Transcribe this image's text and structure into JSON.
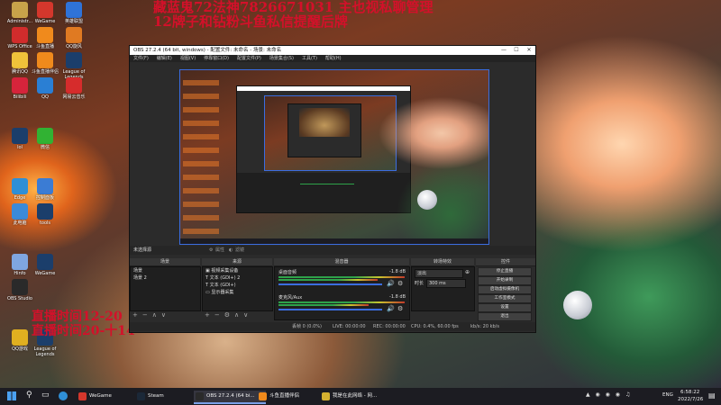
{
  "overlay": {
    "top_line1": "藏蓝鬼72法神7826671031 主也视私聊管理",
    "top_line2": "12牌子和钻粉斗鱼私信提醒后牌",
    "left_line1": "直播时间12-20",
    "left_line2": "直播时间20-十14"
  },
  "desktop_icons": [
    {
      "label": "Administr...",
      "color": "#c8a24a"
    },
    {
      "label": "WeGame",
      "color": "#d4372c"
    },
    {
      "label": "英雄联盟",
      "color": "#2f73d8"
    },
    {
      "label": "WPS Office",
      "color": "#d12c2c"
    },
    {
      "label": "斗鱼直播",
      "color": "#f08a1c"
    },
    {
      "label": "QQ旋风",
      "color": "#e07a22"
    },
    {
      "label": "腾讯QQ",
      "color": "#f0c23a"
    },
    {
      "label": "斗鱼直播伴侣",
      "color": "#f08a1c"
    },
    {
      "label": "League of Legends",
      "color": "#1b3e6b"
    },
    {
      "label": "Bilibili",
      "color": "#d6243b"
    },
    {
      "label": "QQ",
      "color": "#2a7fd4"
    },
    {
      "label": "网易云音乐",
      "color": "#d62c2c"
    },
    {
      "label": "lol",
      "color": "#1b3e6b"
    },
    {
      "label": "微信",
      "color": "#31b233"
    },
    {
      "label": "Edge",
      "color": "#2f8fd6"
    },
    {
      "label": "控制面板",
      "color": "#3b7cd4"
    },
    {
      "label": "此电脑",
      "color": "#3b8ad8"
    },
    {
      "label": "tools",
      "color": "#1b3e6b"
    },
    {
      "label": "Hinfo",
      "color": "#7fa6e0"
    },
    {
      "label": "WeGame",
      "color": "#1b3e6b"
    },
    {
      "label": "OBS Studio",
      "color": "#2a2a2a"
    },
    {
      "label": "QQ游戏",
      "color": "#e0b020"
    },
    {
      "label": "League of Legends",
      "color": "#1b3e6b"
    }
  ],
  "obs": {
    "title": "OBS 27.2.4 (64 bit, windows) - 配置文件: 未命名 - 场景: 未命名",
    "window_controls": [
      "—",
      "☐",
      "✕"
    ],
    "menu": [
      "文件(F)",
      "编辑(E)",
      "视图(V)",
      "停靠窗口(D)",
      "配置文件(P)",
      "场景集合(S)",
      "工具(T)",
      "帮助(H)"
    ],
    "context_bar": {
      "no_source": "未选择源",
      "properties": "属性",
      "filters": "滤镜"
    },
    "docks": {
      "scenes": "场景",
      "sources": "来源",
      "mixer": "混音器",
      "transitions": "转场特效",
      "controls": "控件"
    },
    "scenes_list": [
      "场景",
      "场景 2"
    ],
    "sources_list": [
      "视频采集设备",
      "文本 (GDI+) 2",
      "文本 (GDI+)",
      "显示器采集"
    ],
    "mixer": [
      {
        "name": "桌面音频",
        "db": "-1.8 dB"
      },
      {
        "name": "麦克风/Aux",
        "db": "-1.8 dB"
      }
    ],
    "transitions": {
      "type": "淡出",
      "duration_label": "时长",
      "duration_value": "300 ms"
    },
    "controls": [
      "停止直播",
      "开始录制",
      "启动虚拟摄像机",
      "工作室模式",
      "设置",
      "退出"
    ],
    "status": {
      "dropped": "丢帧 0 (0.0%)",
      "live": "LIVE: 00:00:00",
      "rec": "REC: 00:00:00",
      "cpu": "CPU: 0.4%, 60.00 fps",
      "net": "kb/s: 20 kb/s"
    }
  },
  "taskbar": {
    "items": [
      {
        "label": "WeGame",
        "color": "#d4372c",
        "active": false
      },
      {
        "label": "Steam",
        "color": "#1b2838",
        "active": false
      },
      {
        "label": "OBS 27.2.4 (64 bi...",
        "color": "#2a2a2a",
        "active": true
      },
      {
        "label": "斗鱼直播伴侣",
        "color": "#f08a1c",
        "active": false
      },
      {
        "label": "我是在此网络 - 网...",
        "color": "#d4b030",
        "active": false
      }
    ],
    "lang": "ENG",
    "time": "6:58:22",
    "date": "2022/7/26"
  },
  "colors": {
    "obs_preview_border": "#3b6de0",
    "overlay_red": "#d4102a",
    "accent": "#2f73d8"
  }
}
